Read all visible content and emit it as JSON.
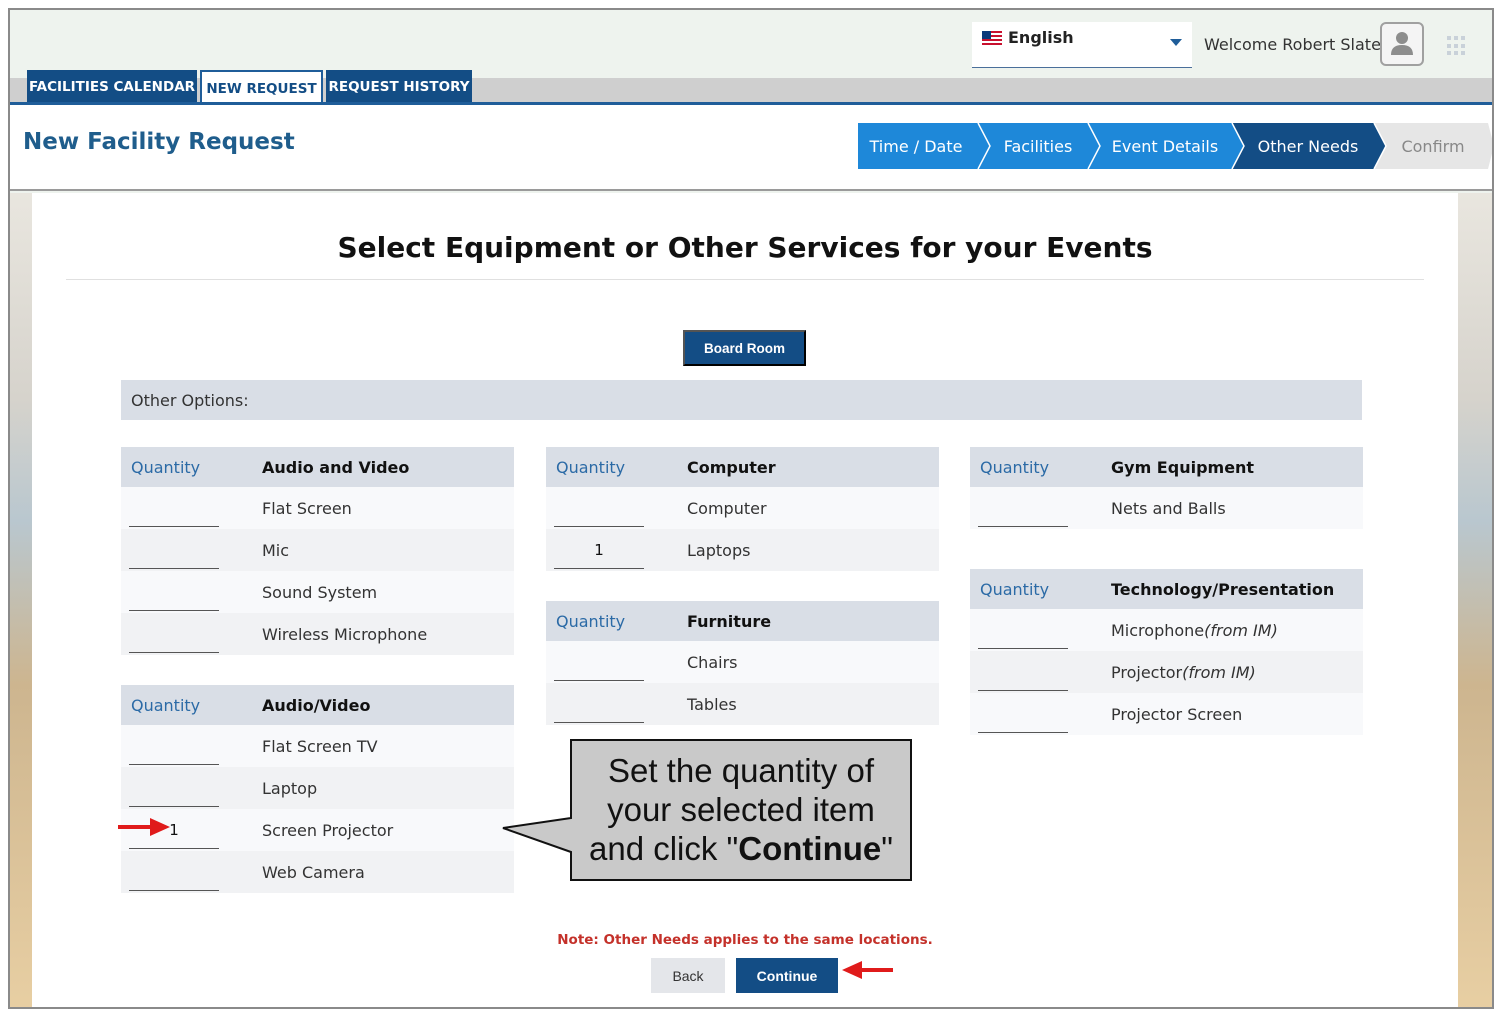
{
  "header": {
    "language": "English",
    "welcome": "Welcome Robert Slater"
  },
  "tabs": [
    {
      "label": "FACILITIES CALENDAR",
      "active": false
    },
    {
      "label": "NEW REQUEST",
      "active": true
    },
    {
      "label": "REQUEST HISTORY",
      "active": false
    }
  ],
  "page_title": "New Facility Request",
  "steps": [
    {
      "label": "Time / Date",
      "state": "done"
    },
    {
      "label": "Facilities",
      "state": "done"
    },
    {
      "label": "Event Details",
      "state": "done"
    },
    {
      "label": "Other Needs",
      "state": "current"
    },
    {
      "label": "Confirm",
      "state": "todo"
    }
  ],
  "main": {
    "heading": "Select Equipment or Other Services for your Events",
    "location_button": "Board Room",
    "other_options_label": "Other Options:",
    "note": "Note: Other Needs applies to the same locations.",
    "back_label": "Back",
    "continue_label": "Continue"
  },
  "tables": {
    "audio_and_video": {
      "qty_header": "Quantity",
      "category": "Audio and Video",
      "items": [
        {
          "name": "Flat Screen",
          "qty": ""
        },
        {
          "name": "Mic",
          "qty": ""
        },
        {
          "name": "Sound System",
          "qty": ""
        },
        {
          "name": "Wireless Microphone",
          "qty": ""
        }
      ]
    },
    "audio_video": {
      "qty_header": "Quantity",
      "category": "Audio/Video",
      "items": [
        {
          "name": "Flat Screen TV",
          "qty": ""
        },
        {
          "name": "Laptop",
          "qty": ""
        },
        {
          "name": "Screen Projector",
          "qty": "1"
        },
        {
          "name": "Web Camera",
          "qty": ""
        }
      ]
    },
    "computer": {
      "qty_header": "Quantity",
      "category": "Computer",
      "items": [
        {
          "name": "Computer",
          "qty": ""
        },
        {
          "name": "Laptops",
          "qty": "1"
        }
      ]
    },
    "furniture": {
      "qty_header": "Quantity",
      "category": "Furniture",
      "items": [
        {
          "name": "Chairs",
          "qty": ""
        },
        {
          "name": "Tables",
          "qty": ""
        }
      ]
    },
    "gym_equipment": {
      "qty_header": "Quantity",
      "category": "Gym Equipment",
      "items": [
        {
          "name": "Nets and Balls",
          "qty": ""
        }
      ]
    },
    "technology": {
      "qty_header": "Quantity",
      "category": "Technology/Presentation",
      "items": [
        {
          "name": "Microphone",
          "suffix": "(from IM)",
          "qty": ""
        },
        {
          "name": "Projector",
          "suffix": "(from IM)",
          "qty": ""
        },
        {
          "name": "Projector Screen",
          "qty": ""
        }
      ]
    }
  },
  "callout": {
    "line1": "Set the quantity of",
    "line2": "your selected item",
    "line3_prefix": "and click \"",
    "line3_bold": "Continue",
    "line3_suffix": "\""
  },
  "colors": {
    "primary": "#134d85",
    "step_done": "#1e88d9",
    "step_current": "#134d85",
    "step_todo": "#e6e6e6",
    "note_red": "#c4312a",
    "arrow_red": "#e01b1b",
    "callout_fill": "#c9c9c9"
  }
}
